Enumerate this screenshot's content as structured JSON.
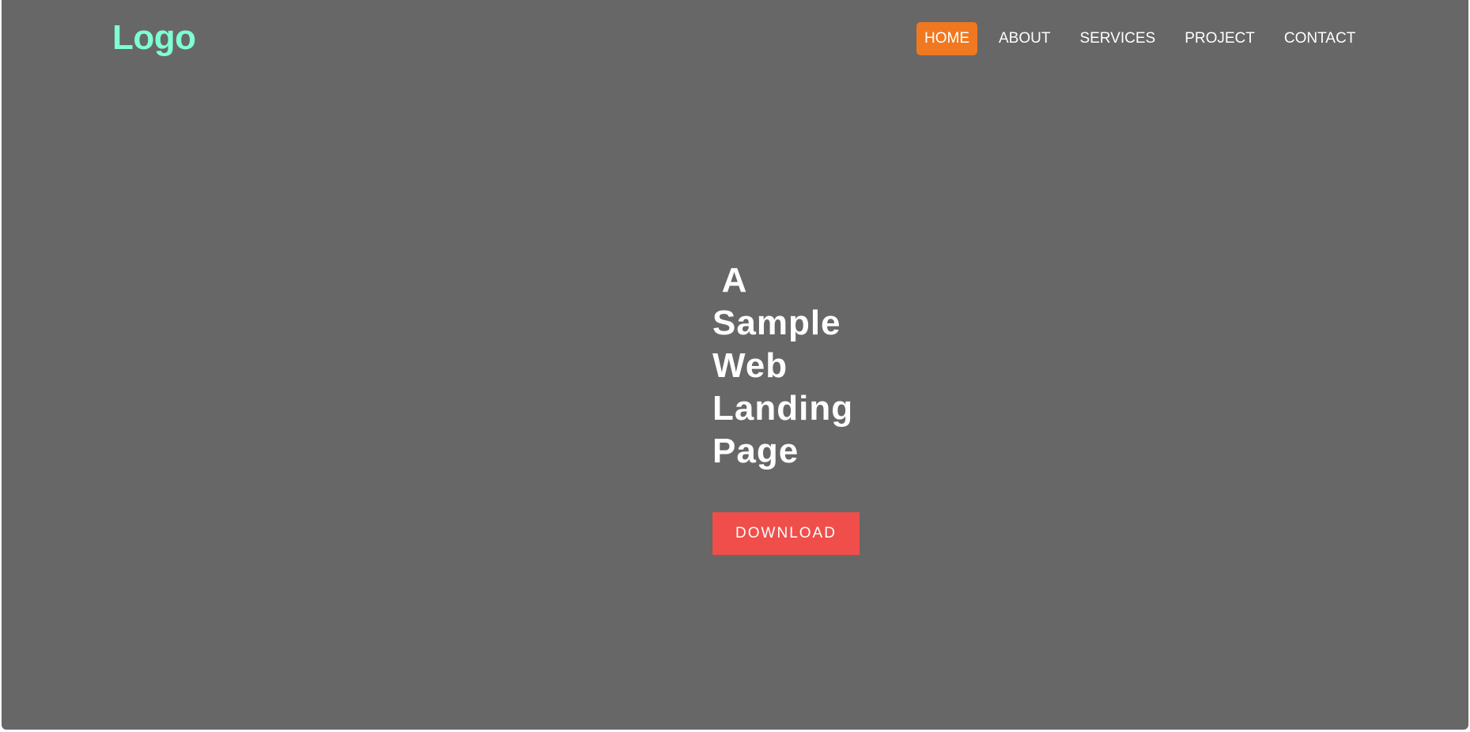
{
  "header": {
    "logo_text": "Logo",
    "nav": [
      {
        "label": "HOME",
        "active": true
      },
      {
        "label": "ABOUT",
        "active": false
      },
      {
        "label": "SERVICES",
        "active": false
      },
      {
        "label": "PROJECT",
        "active": false
      },
      {
        "label": "CONTACT",
        "active": false
      }
    ]
  },
  "hero": {
    "title_lines": [
      " A",
      "Sample",
      "Web",
      "Landing",
      "Page"
    ],
    "download_label": "DOWNLOAD"
  },
  "colors": {
    "background": "#676767",
    "logo": "#7fffd4",
    "nav_active": "#f07820",
    "download_button": "#f04e4a",
    "text": "#ffffff"
  }
}
